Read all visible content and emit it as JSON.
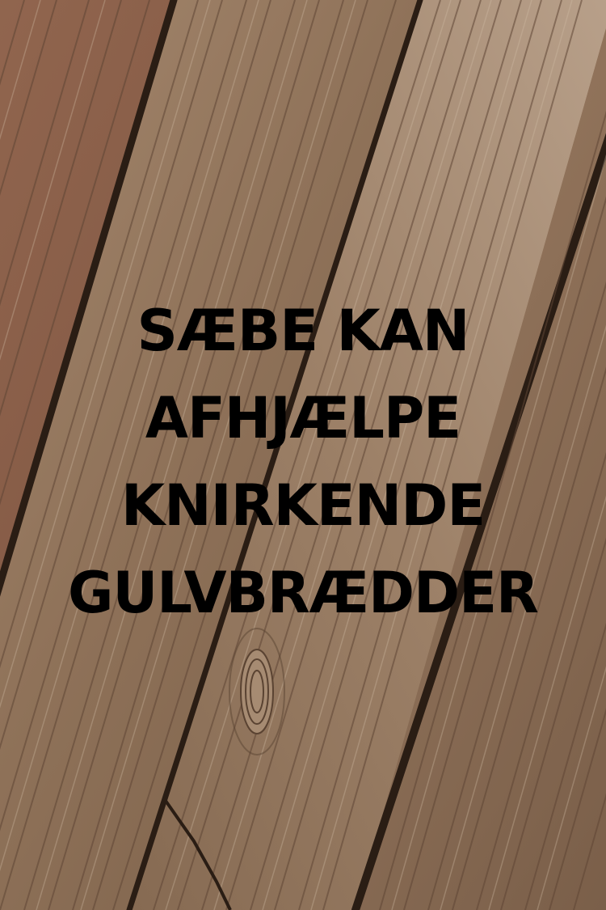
{
  "headline": {
    "lines": [
      "SÆBE KAN",
      "AFHJÆLPE",
      "KNIRKENDE",
      "GULVBRÆDDER"
    ]
  },
  "background": {
    "subject": "weathered wooden floorboards",
    "colors": {
      "wood_light": "#b09378",
      "wood_mid": "#8c6f55",
      "wood_dark": "#5e4634",
      "gap": "#2a1d14",
      "text": "#000000"
    }
  }
}
